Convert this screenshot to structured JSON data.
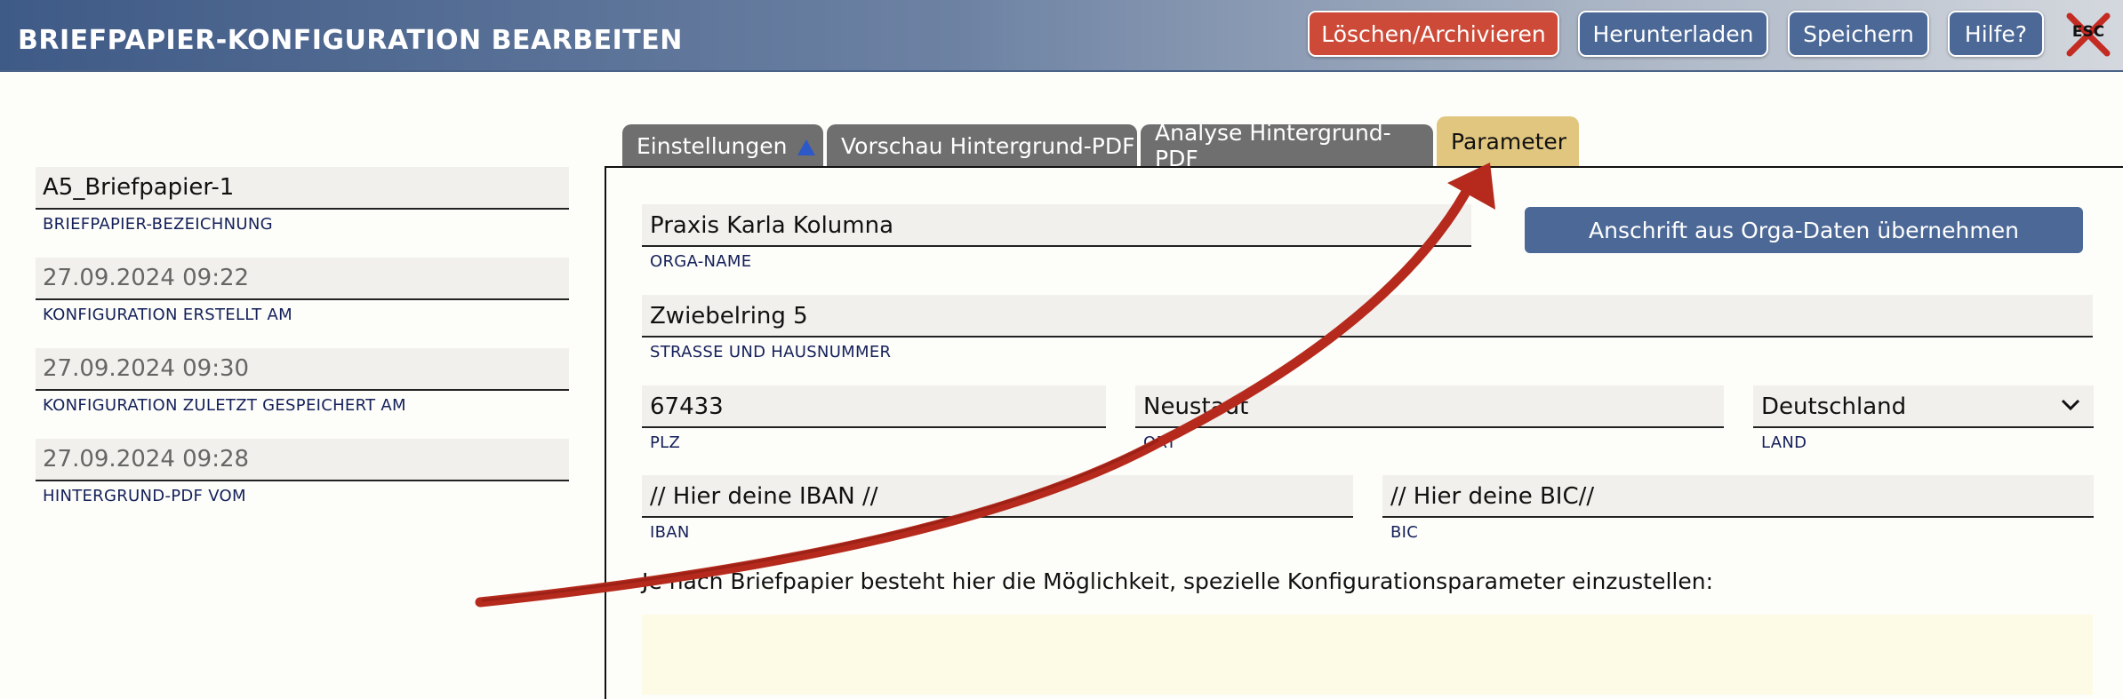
{
  "header": {
    "title": "BRIEFPAPIER-KONFIGURATION BEARBEITEN",
    "buttons": {
      "delete": "Löschen/Archivieren",
      "download": "Herunterladen",
      "save": "Speichern",
      "help": "Hilfe?"
    },
    "esc_label": "ESC",
    "esc_icon": "close-esc-icon"
  },
  "left": {
    "fields": [
      {
        "value": "A5_Briefpapier-1",
        "caption": "BRIEFPAPIER-BEZEICHNUNG"
      },
      {
        "value": "27.09.2024 09:22",
        "caption": "KONFIGURATION ERSTELLT AM"
      },
      {
        "value": "27.09.2024 09:30",
        "caption": "KONFIGURATION ZULETZT GESPEICHERT AM"
      },
      {
        "value": "27.09.2024 09:28",
        "caption": "HINTERGRUND-PDF VOM"
      }
    ]
  },
  "tabs": [
    {
      "label": "Einstellungen",
      "icon": "triangle-up-icon"
    },
    {
      "label": "Vorschau Hintergrund-PDF"
    },
    {
      "label": "Analyse Hintergrund-PDF"
    },
    {
      "label": "Parameter",
      "active": true
    }
  ],
  "form": {
    "orga_name": {
      "value": "Praxis Karla Kolumna",
      "caption": "ORGA-NAME"
    },
    "orga_button": "Anschrift aus Orga-Daten übernehmen",
    "street": {
      "value": "Zwiebelring 5",
      "caption": "STRASSE UND HAUSNUMMER"
    },
    "plz": {
      "value": "67433",
      "caption": "PLZ"
    },
    "ort": {
      "value": "Neustadt",
      "caption": "ORT"
    },
    "land": {
      "value": "Deutschland",
      "caption": "LAND"
    },
    "iban": {
      "value": "// Hier deine IBAN //",
      "caption": "IBAN"
    },
    "bic": {
      "value": "// Hier deine BIC//",
      "caption": "BIC"
    },
    "hint": "Je nach Briefpapier besteht hier die Möglichkeit, spezielle Konfigurationsparameter einzustellen:"
  },
  "colors": {
    "header_start": "#3e5a86",
    "button_blue": "#4b6896",
    "button_red": "#cc4a37",
    "tab_inactive": "#6f6f6f",
    "tab_active": "#e1c67f",
    "annotation_arrow": "#b52a1c"
  }
}
